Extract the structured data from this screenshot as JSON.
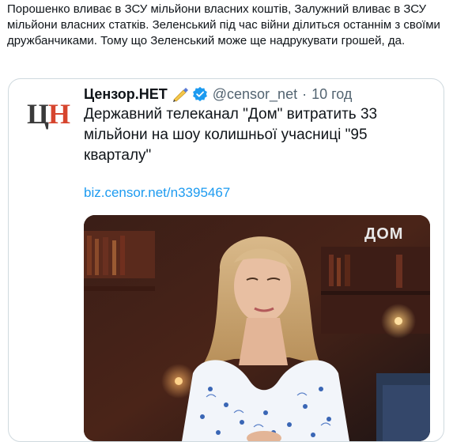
{
  "post": {
    "text": "Порошенко вливає в ЗСУ мільйони власних коштів, Залужний вливає в ЗСУ мільйони власних статків. Зеленський під час війни ділиться останнім з своїми дружбанчиками. Тому що Зеленський може ще надрукувати грошей, да."
  },
  "quote": {
    "avatar_logo": "ЦН",
    "display_name": "Цензор.НЕТ",
    "handle": "@censor_net",
    "separator": "·",
    "time": "10 год",
    "body": "Державний телеканал \"Дом\" витратить 33 мільйони на шоу колишньої учасниці \"95 кварталу\"",
    "link": "biz.censor.net/n3395467",
    "media_watermark": "ДОМ"
  },
  "colors": {
    "link": "#1d9bf0",
    "verified": "#1d9bf0",
    "secondary_text": "#536471",
    "border": "#cfd9de",
    "logo_dark": "#3a3a3a",
    "logo_red": "#d6452e"
  },
  "icons": {
    "pen": "writing-hand-icon",
    "verified": "verified-badge-icon"
  }
}
